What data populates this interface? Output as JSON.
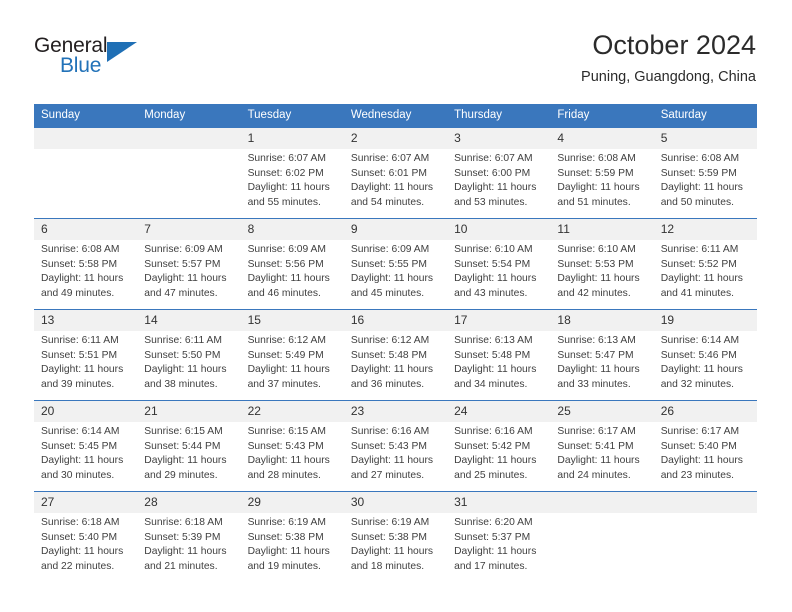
{
  "brand": {
    "name_top": "General",
    "name_bottom": "Blue",
    "triangle_icon": "blue-triangle-icon",
    "color_dark": "#231f20",
    "color_blue": "#2272b8"
  },
  "header": {
    "title": "October 2024",
    "subtitle": "Puning, Guangdong, China"
  },
  "theme": {
    "header_blue": "#3a77bd",
    "daynum_band": "#f1f1f1",
    "text": "#3f3f3f"
  },
  "calendar": {
    "weekdays": [
      "Sunday",
      "Monday",
      "Tuesday",
      "Wednesday",
      "Thursday",
      "Friday",
      "Saturday"
    ],
    "weeks": [
      [
        {
          "day": "",
          "lines": []
        },
        {
          "day": "",
          "lines": []
        },
        {
          "day": "1",
          "lines": [
            "Sunrise: 6:07 AM",
            "Sunset: 6:02 PM",
            "Daylight: 11 hours",
            "and 55 minutes."
          ]
        },
        {
          "day": "2",
          "lines": [
            "Sunrise: 6:07 AM",
            "Sunset: 6:01 PM",
            "Daylight: 11 hours",
            "and 54 minutes."
          ]
        },
        {
          "day": "3",
          "lines": [
            "Sunrise: 6:07 AM",
            "Sunset: 6:00 PM",
            "Daylight: 11 hours",
            "and 53 minutes."
          ]
        },
        {
          "day": "4",
          "lines": [
            "Sunrise: 6:08 AM",
            "Sunset: 5:59 PM",
            "Daylight: 11 hours",
            "and 51 minutes."
          ]
        },
        {
          "day": "5",
          "lines": [
            "Sunrise: 6:08 AM",
            "Sunset: 5:59 PM",
            "Daylight: 11 hours",
            "and 50 minutes."
          ]
        }
      ],
      [
        {
          "day": "6",
          "lines": [
            "Sunrise: 6:08 AM",
            "Sunset: 5:58 PM",
            "Daylight: 11 hours",
            "and 49 minutes."
          ]
        },
        {
          "day": "7",
          "lines": [
            "Sunrise: 6:09 AM",
            "Sunset: 5:57 PM",
            "Daylight: 11 hours",
            "and 47 minutes."
          ]
        },
        {
          "day": "8",
          "lines": [
            "Sunrise: 6:09 AM",
            "Sunset: 5:56 PM",
            "Daylight: 11 hours",
            "and 46 minutes."
          ]
        },
        {
          "day": "9",
          "lines": [
            "Sunrise: 6:09 AM",
            "Sunset: 5:55 PM",
            "Daylight: 11 hours",
            "and 45 minutes."
          ]
        },
        {
          "day": "10",
          "lines": [
            "Sunrise: 6:10 AM",
            "Sunset: 5:54 PM",
            "Daylight: 11 hours",
            "and 43 minutes."
          ]
        },
        {
          "day": "11",
          "lines": [
            "Sunrise: 6:10 AM",
            "Sunset: 5:53 PM",
            "Daylight: 11 hours",
            "and 42 minutes."
          ]
        },
        {
          "day": "12",
          "lines": [
            "Sunrise: 6:11 AM",
            "Sunset: 5:52 PM",
            "Daylight: 11 hours",
            "and 41 minutes."
          ]
        }
      ],
      [
        {
          "day": "13",
          "lines": [
            "Sunrise: 6:11 AM",
            "Sunset: 5:51 PM",
            "Daylight: 11 hours",
            "and 39 minutes."
          ]
        },
        {
          "day": "14",
          "lines": [
            "Sunrise: 6:11 AM",
            "Sunset: 5:50 PM",
            "Daylight: 11 hours",
            "and 38 minutes."
          ]
        },
        {
          "day": "15",
          "lines": [
            "Sunrise: 6:12 AM",
            "Sunset: 5:49 PM",
            "Daylight: 11 hours",
            "and 37 minutes."
          ]
        },
        {
          "day": "16",
          "lines": [
            "Sunrise: 6:12 AM",
            "Sunset: 5:48 PM",
            "Daylight: 11 hours",
            "and 36 minutes."
          ]
        },
        {
          "day": "17",
          "lines": [
            "Sunrise: 6:13 AM",
            "Sunset: 5:48 PM",
            "Daylight: 11 hours",
            "and 34 minutes."
          ]
        },
        {
          "day": "18",
          "lines": [
            "Sunrise: 6:13 AM",
            "Sunset: 5:47 PM",
            "Daylight: 11 hours",
            "and 33 minutes."
          ]
        },
        {
          "day": "19",
          "lines": [
            "Sunrise: 6:14 AM",
            "Sunset: 5:46 PM",
            "Daylight: 11 hours",
            "and 32 minutes."
          ]
        }
      ],
      [
        {
          "day": "20",
          "lines": [
            "Sunrise: 6:14 AM",
            "Sunset: 5:45 PM",
            "Daylight: 11 hours",
            "and 30 minutes."
          ]
        },
        {
          "day": "21",
          "lines": [
            "Sunrise: 6:15 AM",
            "Sunset: 5:44 PM",
            "Daylight: 11 hours",
            "and 29 minutes."
          ]
        },
        {
          "day": "22",
          "lines": [
            "Sunrise: 6:15 AM",
            "Sunset: 5:43 PM",
            "Daylight: 11 hours",
            "and 28 minutes."
          ]
        },
        {
          "day": "23",
          "lines": [
            "Sunrise: 6:16 AM",
            "Sunset: 5:43 PM",
            "Daylight: 11 hours",
            "and 27 minutes."
          ]
        },
        {
          "day": "24",
          "lines": [
            "Sunrise: 6:16 AM",
            "Sunset: 5:42 PM",
            "Daylight: 11 hours",
            "and 25 minutes."
          ]
        },
        {
          "day": "25",
          "lines": [
            "Sunrise: 6:17 AM",
            "Sunset: 5:41 PM",
            "Daylight: 11 hours",
            "and 24 minutes."
          ]
        },
        {
          "day": "26",
          "lines": [
            "Sunrise: 6:17 AM",
            "Sunset: 5:40 PM",
            "Daylight: 11 hours",
            "and 23 minutes."
          ]
        }
      ],
      [
        {
          "day": "27",
          "lines": [
            "Sunrise: 6:18 AM",
            "Sunset: 5:40 PM",
            "Daylight: 11 hours",
            "and 22 minutes."
          ]
        },
        {
          "day": "28",
          "lines": [
            "Sunrise: 6:18 AM",
            "Sunset: 5:39 PM",
            "Daylight: 11 hours",
            "and 21 minutes."
          ]
        },
        {
          "day": "29",
          "lines": [
            "Sunrise: 6:19 AM",
            "Sunset: 5:38 PM",
            "Daylight: 11 hours",
            "and 19 minutes."
          ]
        },
        {
          "day": "30",
          "lines": [
            "Sunrise: 6:19 AM",
            "Sunset: 5:38 PM",
            "Daylight: 11 hours",
            "and 18 minutes."
          ]
        },
        {
          "day": "31",
          "lines": [
            "Sunrise: 6:20 AM",
            "Sunset: 5:37 PM",
            "Daylight: 11 hours",
            "and 17 minutes."
          ]
        },
        {
          "day": "",
          "lines": []
        },
        {
          "day": "",
          "lines": []
        }
      ]
    ]
  }
}
